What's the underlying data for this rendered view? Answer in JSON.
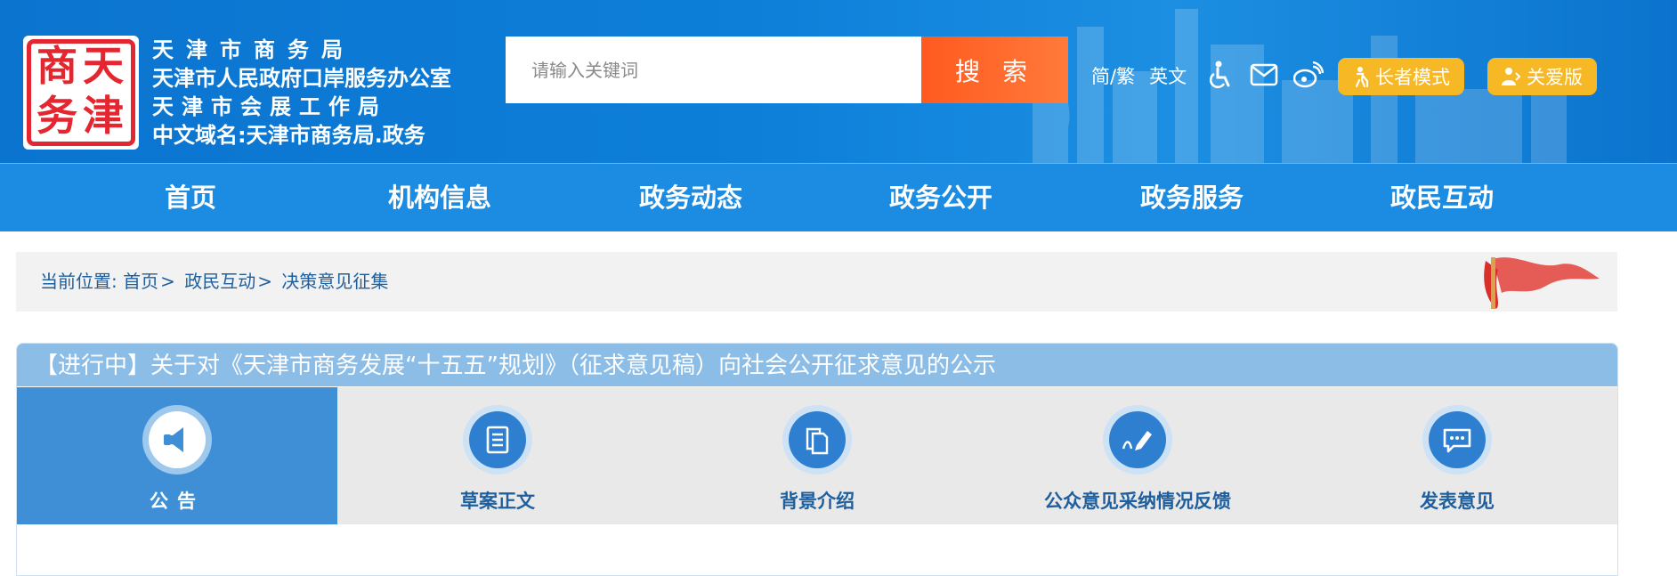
{
  "header": {
    "logo_chars": [
      "天",
      "津",
      "商",
      "务"
    ],
    "org_names": [
      "天津市商务局",
      "天津市人民政府口岸服务办公室",
      "天津市会展工作局",
      "中文域名:天津市商务局.政务"
    ],
    "search": {
      "placeholder": "请输入关键词",
      "button_label": "搜 索"
    },
    "links": [
      "简/繁",
      "英文"
    ],
    "icons": [
      "accessibility-icon",
      "mail-icon",
      "weibo-icon"
    ],
    "modes": [
      {
        "label": "长者模式",
        "icon": "elder-icon"
      },
      {
        "label": "关爱版",
        "icon": "care-icon"
      }
    ],
    "colors": {
      "header_blue": "#0d7fd9",
      "search_orange": "#ff5a1f",
      "mode_yellow": "#f6b824"
    }
  },
  "nav": {
    "items": [
      "首页",
      "机构信息",
      "政务动态",
      "政务公开",
      "政务服务",
      "政民互动"
    ]
  },
  "breadcrumb": {
    "prefix": "当前位置:",
    "items": [
      "首页",
      "政民互动",
      "决策意见征集"
    ],
    "separator": ">"
  },
  "notice": {
    "title": "【进行中】关于对《天津市商务发展“十五五”规划》（征求意见稿）向社会公开征求意见的公示",
    "tabs": [
      {
        "label": "公告",
        "icon": "megaphone-icon",
        "active": true
      },
      {
        "label": "草案正文",
        "icon": "document-icon",
        "active": false
      },
      {
        "label": "背景介绍",
        "icon": "files-icon",
        "active": false
      },
      {
        "label": "公众意见采纳情况反馈",
        "icon": "pen-feedback-icon",
        "active": false
      },
      {
        "label": "发表意见",
        "icon": "chat-bubble-icon",
        "active": false
      }
    ]
  }
}
